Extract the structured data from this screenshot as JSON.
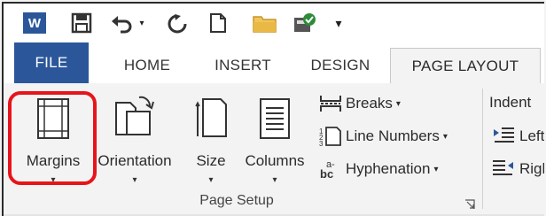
{
  "quick_access": {
    "app_icon_letter": "W",
    "more_glyph": "▾"
  },
  "tabs": [
    {
      "label": "FILE"
    },
    {
      "label": "HOME"
    },
    {
      "label": "INSERT"
    },
    {
      "label": "DESIGN"
    },
    {
      "label": "PAGE LAYOUT",
      "active": true
    }
  ],
  "page_setup": {
    "group_label": "Page Setup",
    "margins": "Margins",
    "orientation": "Orientation",
    "size": "Size",
    "columns": "Columns",
    "breaks": "Breaks",
    "line_numbers": "Line Numbers",
    "hyphenation": "Hyphenation",
    "caret": "▾"
  },
  "paragraph": {
    "indent": "Indent",
    "left": "Left",
    "right": "Right"
  },
  "colors": {
    "accent": "#2b579a",
    "highlight": "#e8141a"
  }
}
